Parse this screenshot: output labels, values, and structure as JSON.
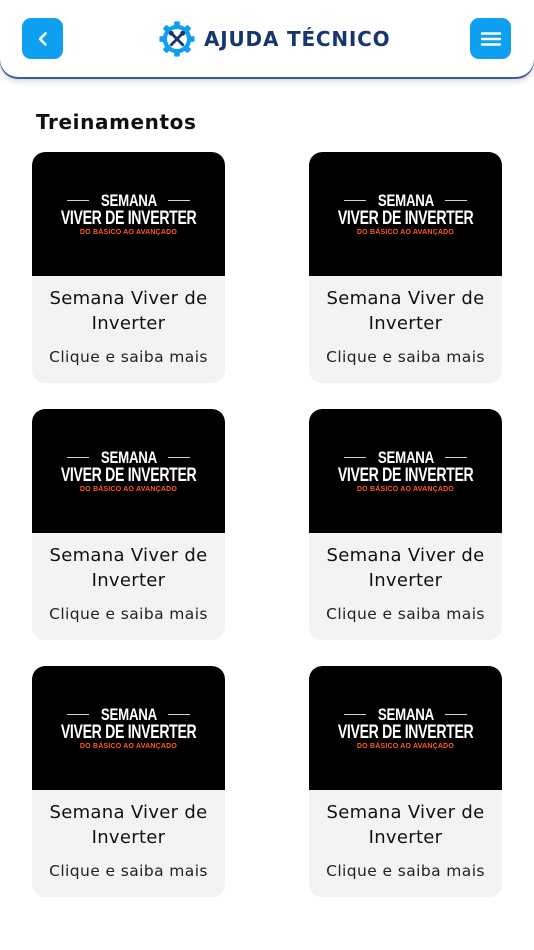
{
  "header": {
    "back_icon": "chevron-left-icon",
    "menu_icon": "hamburger-menu-icon",
    "brand_title": "AJUDA TÉCNICO",
    "brand_logo": "gear-tools-logo",
    "colors": {
      "accent": "#0f9ff0",
      "brand_text": "#16366e"
    }
  },
  "section": {
    "title": "Treinamentos"
  },
  "cards": [
    {
      "banner": {
        "line1": "SEMANA",
        "line2": "VIVER DE INVERTER",
        "line3": "DO BÁSICO AO AVANÇADO"
      },
      "title": "Semana Viver de Inverter",
      "cta": "Clique e saiba mais"
    },
    {
      "banner": {
        "line1": "SEMANA",
        "line2": "VIVER DE INVERTER",
        "line3": "DO BÁSICO AO AVANÇADO"
      },
      "title": "Semana Viver de Inverter",
      "cta": "Clique e saiba mais"
    },
    {
      "banner": {
        "line1": "SEMANA",
        "line2": "VIVER DE INVERTER",
        "line3": "DO BÁSICO AO AVANÇADO"
      },
      "title": "Semana Viver de Inverter",
      "cta": "Clique e saiba mais"
    },
    {
      "banner": {
        "line1": "SEMANA",
        "line2": "VIVER DE INVERTER",
        "line3": "DO BÁSICO AO AVANÇADO"
      },
      "title": "Semana Viver de Inverter",
      "cta": "Clique e saiba mais"
    },
    {
      "banner": {
        "line1": "SEMANA",
        "line2": "VIVER DE INVERTER",
        "line3": "DO BÁSICO AO AVANÇADO"
      },
      "title": "Semana Viver de Inverter",
      "cta": "Clique e saiba mais"
    },
    {
      "banner": {
        "line1": "SEMANA",
        "line2": "VIVER DE INVERTER",
        "line3": "DO BÁSICO AO AVANÇADO"
      },
      "title": "Semana Viver de Inverter",
      "cta": "Clique e saiba mais"
    }
  ]
}
